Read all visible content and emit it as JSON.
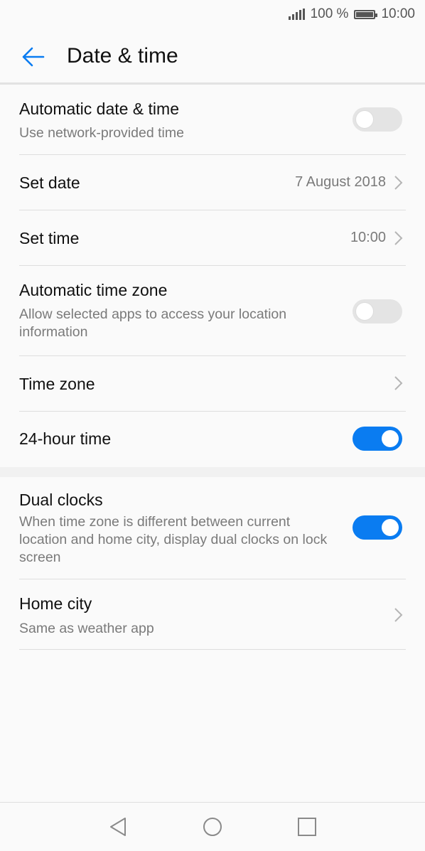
{
  "status_bar": {
    "battery_text": "100 %",
    "time": "10:00",
    "icons": [
      "signal-icon",
      "battery-icon"
    ]
  },
  "header": {
    "title": "Date & time",
    "back_icon": "back-arrow-icon"
  },
  "settings": {
    "auto_date_time": {
      "title": "Automatic date & time",
      "subtitle": "Use network-provided time",
      "enabled": false
    },
    "set_date": {
      "title": "Set date",
      "value": "7 August 2018"
    },
    "set_time": {
      "title": "Set time",
      "value": "10:00"
    },
    "auto_time_zone": {
      "title": "Automatic time zone",
      "subtitle": "Allow selected apps to access your location information",
      "enabled": false
    },
    "time_zone": {
      "title": "Time zone"
    },
    "hour_24": {
      "title": "24-hour time",
      "enabled": true
    },
    "dual_clocks": {
      "title": "Dual clocks",
      "subtitle": "When time zone is different between current location and home city, display dual clocks on lock screen",
      "enabled": true
    },
    "home_city": {
      "title": "Home city",
      "subtitle": "Same as weather app"
    }
  },
  "nav_bar": {
    "icons": [
      "nav-back-icon",
      "nav-home-icon",
      "nav-recents-icon"
    ]
  },
  "colors": {
    "accent": "#0a7cf1",
    "toggle_off": "#e4e4e4",
    "background": "#fafafa"
  }
}
